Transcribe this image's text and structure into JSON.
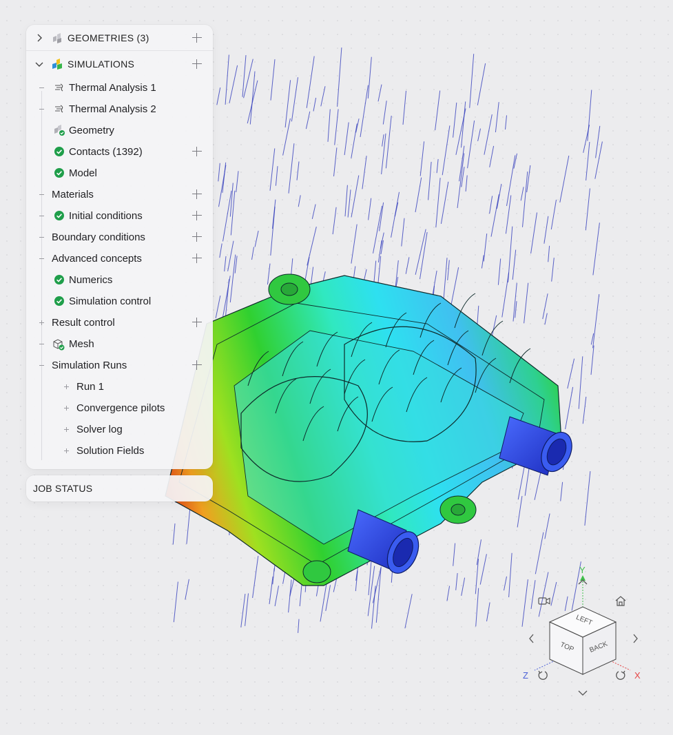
{
  "tree": {
    "geometries_label": "GEOMETRIES (3)",
    "simulations_label": "SIMULATIONS",
    "items": [
      {
        "label": "Thermal Analysis 1"
      },
      {
        "label": "Thermal Analysis 2"
      },
      {
        "label": "Geometry"
      },
      {
        "label": "Contacts (1392)"
      },
      {
        "label": "Model"
      },
      {
        "label": "Materials"
      },
      {
        "label": "Initial conditions"
      },
      {
        "label": "Boundary conditions"
      },
      {
        "label": "Advanced concepts"
      },
      {
        "label": "Numerics"
      },
      {
        "label": "Simulation control"
      },
      {
        "label": "Result control"
      },
      {
        "label": "Mesh"
      },
      {
        "label": "Simulation Runs"
      },
      {
        "label": "Run 1"
      },
      {
        "label": "Convergence pilots"
      },
      {
        "label": "Solver log"
      },
      {
        "label": "Solution Fields"
      }
    ]
  },
  "job_status": {
    "label": "JOB STATUS"
  },
  "nav_cube": {
    "faces": {
      "left": "LEFT",
      "top": "TOP",
      "back": "BACK"
    },
    "axes": {
      "y": "Y",
      "z": "Z",
      "x": "X"
    }
  },
  "colors": {
    "check": "#1f9e4a",
    "axis_x": "#e64545",
    "axis_y": "#3fbf4a",
    "axis_z": "#4a5fd6"
  }
}
